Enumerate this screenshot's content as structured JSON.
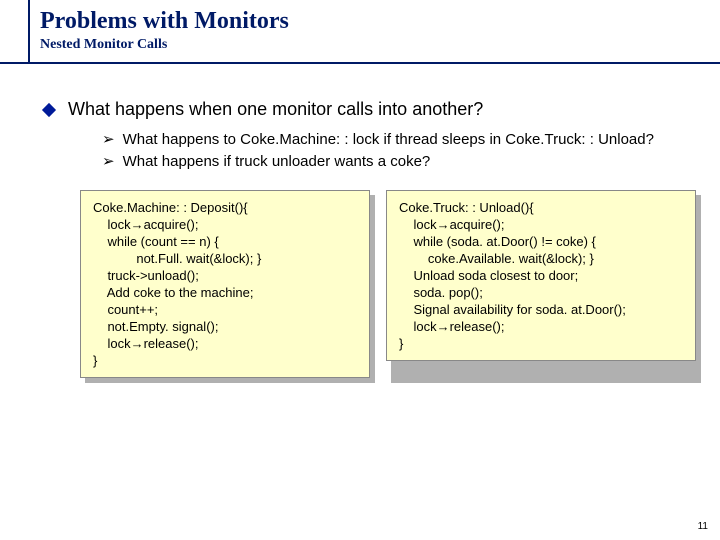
{
  "header": {
    "title": "Problems with Monitors",
    "subtitle": "Nested Monitor Calls"
  },
  "content": {
    "main_bullet": "What happens when one monitor calls into another?",
    "sub_bullets": [
      "What happens to Coke.Machine: : lock if thread sleeps in Coke.Truck: : Unload?",
      "What happens if truck unloader wants a coke?"
    ]
  },
  "code": {
    "left": "Coke.Machine: : Deposit(){\n    lock→acquire();\n    while (count == n) {\n            not.Full. wait(&lock); }\n    truck->unload();\n    Add coke to the machine;\n    count++;\n    not.Empty. signal();\n    lock→release();\n}",
    "right": "Coke.Truck: : Unload(){\n    lock→acquire();\n    while (soda. at.Door() != coke) {\n        coke.Available. wait(&lock); }\n    Unload soda closest to door;\n    soda. pop();\n    Signal availability for soda. at.Door();\n    lock→release();\n}"
  },
  "page_number": "11"
}
